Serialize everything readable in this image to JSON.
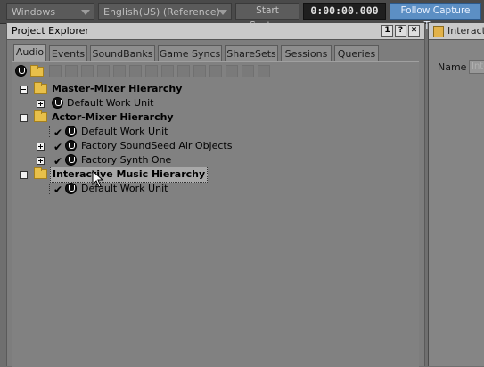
{
  "toolbar": {
    "platform": "Windows",
    "language": "English(US) (Reference)",
    "start_capture": "Start Capture",
    "timecode": "0:00:00.000",
    "follow_capture": "Follow Capture Time"
  },
  "panel": {
    "title": "Project Explorer",
    "buttons": [
      "1",
      "?",
      "✕"
    ],
    "tabs": [
      "Audio",
      "Events",
      "SoundBanks",
      "Game Syncs",
      "ShareSets",
      "Sessions",
      "Queries"
    ],
    "active_tab": "Audio"
  },
  "tree": {
    "master_mixer": {
      "label": "Master-Mixer Hierarchy",
      "children": [
        "Default Work Unit"
      ]
    },
    "actor_mixer": {
      "label": "Actor-Mixer Hierarchy",
      "children": [
        "Default Work Unit",
        "Factory SoundSeed Air Objects",
        "Factory Synth One"
      ]
    },
    "interactive_music": {
      "label": "Interactive Music Hierarchy",
      "children": [
        "Default Work Unit"
      ]
    }
  },
  "right_panel": {
    "title": "Interactive",
    "name_label": "Name",
    "name_value": "Inte"
  },
  "colors": {
    "follow_button": "#5c8fc4",
    "folder": "#e8c04a",
    "panel_bg": "#7d7d7d"
  }
}
